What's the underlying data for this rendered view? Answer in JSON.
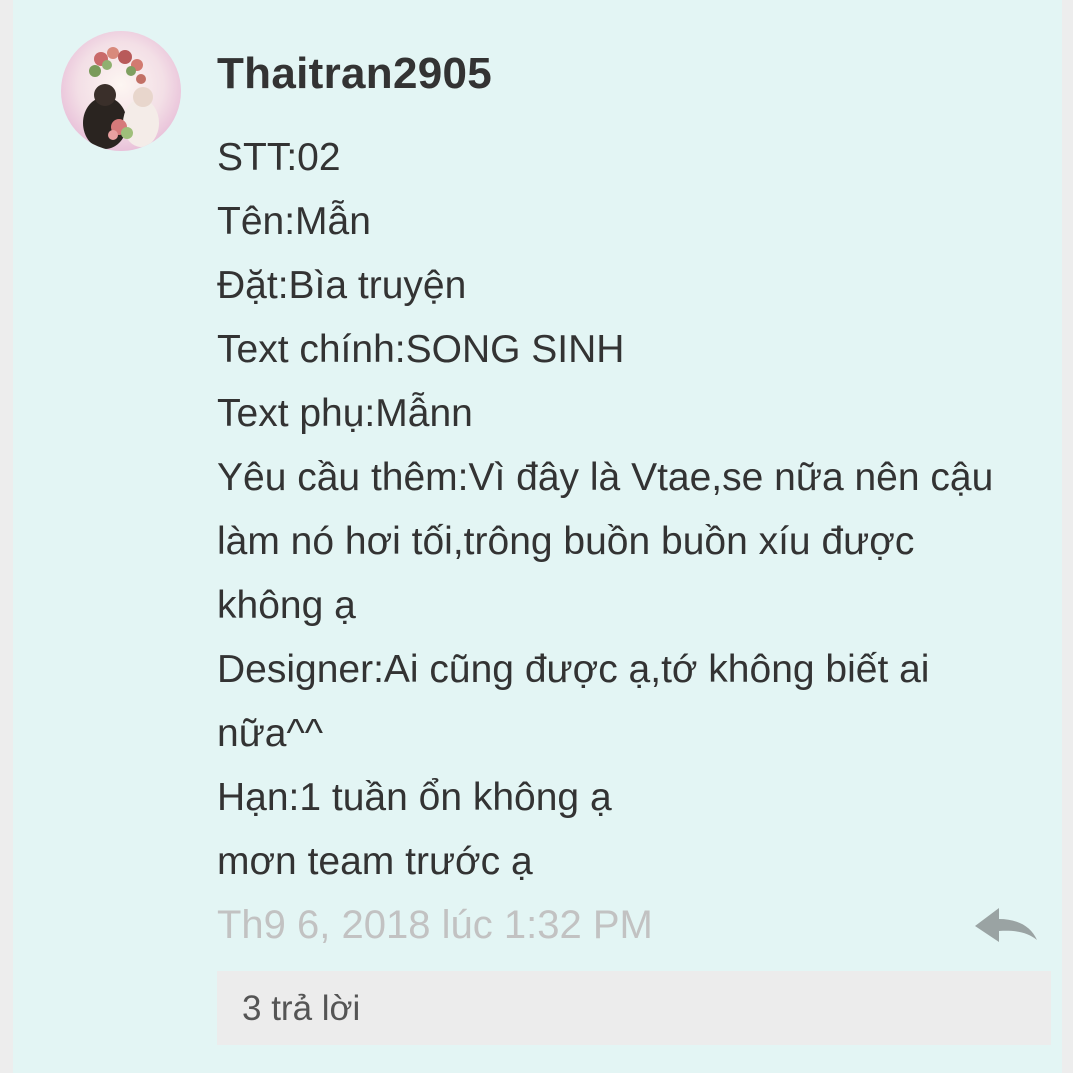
{
  "comment": {
    "avatar": "avatar-photo",
    "username": "Thaitran2905",
    "lines": [
      "STT:02",
      "Tên:Mẫn",
      "Đặt:Bìa truyện",
      "Text chính:SONG SINH",
      "Text phụ:Mẫnn",
      "Yêu cầu thêm:Vì đây là Vtae,se nữa nên cậu",
      "làm nó hơi tối,trông buồn buồn xíu được",
      "không ạ",
      "Designer:Ai cũng được ạ,tớ không biết ai",
      "nữa^^",
      "Hạn:1 tuần ổn không ạ",
      "mơn team trước ạ"
    ],
    "timestamp": "Th9 6, 2018 lúc 1:32 PM",
    "reply_icon": "reply-arrow-icon",
    "replies_label": "3 trả lời"
  },
  "colors": {
    "card_background": "#e3f5f4",
    "page_background": "#ededed",
    "text": "#333333",
    "timestamp": "#c2c2c2",
    "replies_bar": "#ececec"
  }
}
